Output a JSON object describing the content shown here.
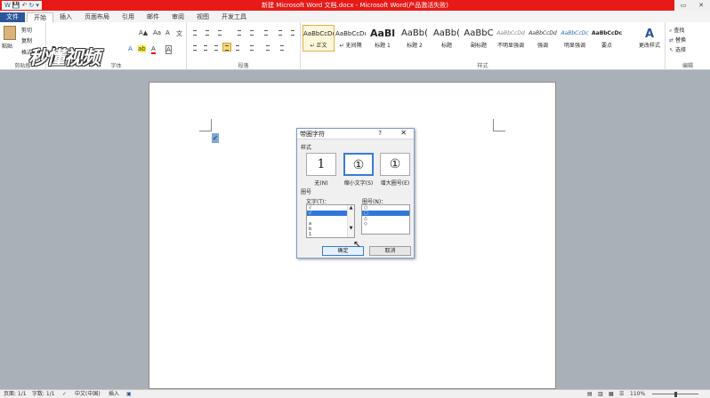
{
  "window": {
    "title": "新建 Microsoft Word 文档.docx - Microsoft Word(产品激活失败)",
    "qat_items": [
      "W",
      "💾",
      "↶",
      "↻",
      "▾"
    ],
    "controls": [
      "▭",
      "✕"
    ]
  },
  "tabs": [
    "文件",
    "开始",
    "插入",
    "页面布局",
    "引用",
    "邮件",
    "审阅",
    "视图",
    "开发工具"
  ],
  "ribbon": {
    "clipboard": {
      "paste": "粘贴",
      "cut": "剪切",
      "copy": "复制",
      "format_painter": "格式刷",
      "label": "剪贴板"
    },
    "font": {
      "label": "字体",
      "font_size": "A▲",
      "bold": "B",
      "italic": "I",
      "underline": "U",
      "abc": "abc",
      "effects": "A",
      "highlight": "ab",
      "color": "A",
      "aa": "Aa",
      "clear": "A",
      "phonetic": "文",
      "border": "A"
    },
    "paragraph": {
      "label": "段落"
    },
    "styles": {
      "label": "样式",
      "items": [
        {
          "sample": "AaBbCcDd",
          "name": "↵ 正文"
        },
        {
          "sample": "AaBbCcDd",
          "name": "↵ 无间隔"
        },
        {
          "sample": "AaBl",
          "name": "标题 1"
        },
        {
          "sample": "AaBb(",
          "name": "标题 2"
        },
        {
          "sample": "AaBb(",
          "name": "标题"
        },
        {
          "sample": "AaBbC",
          "name": "副标题"
        },
        {
          "sample": "AaBbCcDd",
          "name": "不明显强调"
        },
        {
          "sample": "AaBbCcDd",
          "name": "强调"
        },
        {
          "sample": "AaBbCcDc",
          "name": "明显强调"
        },
        {
          "sample": "AaBbCcDc",
          "name": "要点"
        }
      ],
      "change_styles": "更改样式"
    },
    "editing": {
      "label": "编辑",
      "find": "查找",
      "replace": "替换",
      "select": "选择"
    }
  },
  "watermark_logo": "秒懂视频",
  "document": {
    "selected_char": "✓"
  },
  "dialog": {
    "title": "带圈字符",
    "help": "?",
    "close": "✕",
    "style_label": "样式",
    "styles": [
      {
        "symbol": "1",
        "name": "无(N)"
      },
      {
        "symbol": "①",
        "name": "缩小文字(S)"
      },
      {
        "symbol": "①",
        "name": "增大圈号(E)"
      }
    ],
    "circle_label": "圈号",
    "text_label": "文字(T)：",
    "text_value": "√",
    "text_items": [
      "√",
      "",
      "a",
      "b",
      "1"
    ],
    "circle_list_label": "圈号(N)：",
    "circle_items": [
      "○",
      "□",
      "△",
      "◇"
    ],
    "ok": "确定",
    "cancel": "取消"
  },
  "statusbar": {
    "page": "页面: 1/1",
    "words": "字数: 1/1",
    "language": "中文(中国)",
    "mode": "插入",
    "zoom": "110%"
  }
}
